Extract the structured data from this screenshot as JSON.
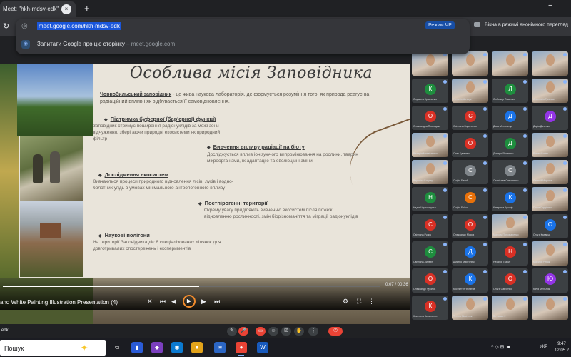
{
  "browser": {
    "tab_title": "Meet: \"hkh-mdsv-edk\"",
    "tab_close": "×",
    "new_tab": "+",
    "minimize": "−",
    "reload_icon": "↻",
    "omnibox": {
      "url": "meet.google.com/hkh-mdsv-edk",
      "suggestion_text": "Запитати Google про цю сторінку",
      "suggestion_dash": " – ",
      "suggestion_url": "meet.google.com"
    },
    "reading_mode": "Режим ЧР",
    "incognito_text": "Вікна в режимі анонімного перегляд"
  },
  "slide": {
    "title": "Особлива місія Заповідника",
    "intro_bold": "Чорнобильський заповідник",
    "intro_rest": " - це жива наукова лабораторія, де формується розуміння того, як природа реагує на радіаційний вплив і як відбувається її самовідновлення.",
    "bullets": [
      {
        "heading": "Підтримка буферної (бар'єрної) функції",
        "text": "Заповідник стримує поширення радіонуклідів за межі зони відчуження, зберігаючи природні екосистеми як природний фільтр"
      },
      {
        "heading": "Вивчення впливу радіації на біоту",
        "text": "Досліджується вплив іонізуючого випромінювання на рослини, тварин і мікроорганізми, їх адаптацію та еволюційні зміни"
      },
      {
        "heading": "Дослідження екосистем",
        "text": "Вивчаються процеси природного відновлення лісів, луків і водно-болотних угідь в умовах мінімального антропогенного впливу"
      },
      {
        "heading": "Постпірогенні території",
        "text": "Окрему увагу приділяють вивченню екосистем після пожеж: відновленню рослинності, змін біорізноманіття та міграції радіонуклідів"
      },
      {
        "heading": "Наукові полігони",
        "text": "На території Заповідника діє 8 спеціалізованих ділянок для довготривалих спостережень і експериментів"
      }
    ]
  },
  "player": {
    "title": "and White Painting Illustration Presentation (4)",
    "time": "0:07 / 00:36",
    "progress": 0.52,
    "controls": {
      "close": "✕",
      "prev": "⏮",
      "back": "◀",
      "play": "▶",
      "fwd": "▶",
      "next": "⏭",
      "settings": "⚙",
      "fullscreen": "⛶",
      "more": "⋮"
    }
  },
  "participants": [
    {
      "initial": "",
      "name": "",
      "color": "#5f6368",
      "photo": true
    },
    {
      "initial": "",
      "name": "",
      "color": "#5f6368",
      "photo": true
    },
    {
      "initial": "",
      "name": "",
      "color": "#5f6368",
      "photo": true
    },
    {
      "initial": "",
      "name": "",
      "color": "#5f6368",
      "photo": true
    },
    {
      "initial": "К",
      "name": "Людмила Кравченко",
      "color": "#1e8e3e",
      "photo": false
    },
    {
      "initial": "",
      "name": "Наталія Шевчук",
      "color": "#5f6368",
      "photo": true
    },
    {
      "initial": "Л",
      "name": "Любомир Ляшенко",
      "color": "#1e8e3e",
      "photo": false
    },
    {
      "initial": "",
      "name": "Анастасія Гринчак",
      "color": "#5f6368",
      "photo": true
    },
    {
      "initial": "О",
      "name": "Олександра Приходько",
      "color": "#d93025",
      "photo": false
    },
    {
      "initial": "С",
      "name": "Світлана Кириленко",
      "color": "#d93025",
      "photo": false
    },
    {
      "initial": "Д",
      "name": "Дана Мельничук",
      "color": "#1a73e8",
      "photo": false
    },
    {
      "initial": "Д",
      "name": "Дарія Дяченко",
      "color": "#9334e6",
      "photo": false
    },
    {
      "initial": "",
      "name": "Валерія Михайленко",
      "color": "#5f6368",
      "photo": true
    },
    {
      "initial": "О",
      "name": "Олег Гуменюк",
      "color": "#d93025",
      "photo": false
    },
    {
      "initial": "Д",
      "name": "Дмитро Яковенко",
      "color": "#1e8e3e",
      "photo": false
    },
    {
      "initial": "",
      "name": "Роман Бойко",
      "color": "#5f6368",
      "photo": true
    },
    {
      "initial": "",
      "name": "Вероніка Бондар",
      "color": "#5f6368",
      "photo": true
    },
    {
      "initial": "С",
      "name": "Софія Бакай",
      "color": "#80868b",
      "photo": false
    },
    {
      "initial": "С",
      "name": "Станіслав Симоненко",
      "color": "#80868b",
      "photo": false
    },
    {
      "initial": "",
      "name": "Євгеній Морозов",
      "color": "#5f6368",
      "photo": true
    },
    {
      "initial": "Н",
      "name": "Надія Чорноморець",
      "color": "#1e8e3e",
      "photo": false
    },
    {
      "initial": "С",
      "name": "Софія Бойко",
      "color": "#e8710a",
      "photo": false
    },
    {
      "initial": "К",
      "name": "Катерина Кушнір",
      "color": "#1a73e8",
      "photo": false
    },
    {
      "initial": "",
      "name": "Ганна Гордієнко",
      "color": "#5f6368",
      "photo": true
    },
    {
      "initial": "С",
      "name": "Світлана Рудик",
      "color": "#d93025",
      "photo": false
    },
    {
      "initial": "О",
      "name": "Олександр Мороз",
      "color": "#d93025",
      "photo": false
    },
    {
      "initial": "",
      "name": "Максим Пономаренко",
      "color": "#5f6368",
      "photo": true
    },
    {
      "initial": "О",
      "name": "Ольга Кравець",
      "color": "#1a73e8",
      "photo": false
    },
    {
      "initial": "С",
      "name": "Світлана Литвин",
      "color": "#1e8e3e",
      "photo": false
    },
    {
      "initial": "Д",
      "name": "Дмитро Мартинюк",
      "color": "#1a73e8",
      "photo": false
    },
    {
      "initial": "Н",
      "name": "Наталія Ткачук",
      "color": "#d93025",
      "photo": false
    },
    {
      "initial": "",
      "name": "Марина Рибак",
      "color": "#5f6368",
      "photo": true
    },
    {
      "initial": "О",
      "name": "Олександр Фролов",
      "color": "#d93025",
      "photo": false
    },
    {
      "initial": "К",
      "name": "Костянтин Філатов",
      "color": "#1a73e8",
      "photo": false
    },
    {
      "initial": "О",
      "name": "Ольга Савченко",
      "color": "#d93025",
      "photo": false
    },
    {
      "initial": "Ю",
      "name": "Юлія Мельник",
      "color": "#9334e6",
      "photo": false
    },
    {
      "initial": "К",
      "name": "Кристина Кириленко",
      "color": "#d93025",
      "photo": false
    },
    {
      "initial": "",
      "name": "Тетяна Пасічник",
      "color": "#5f6368",
      "photo": true
    },
    {
      "initial": "",
      "name": "Ви та ще 2",
      "color": "#5f6368",
      "photo": true
    },
    {
      "initial": "",
      "name": "",
      "color": "#5f6368",
      "photo": true
    }
  ],
  "callbar": {
    "code": "edk",
    "buttons": [
      "✎",
      "🎤",
      "▭",
      "☺",
      "⎚",
      "✋",
      "⋮",
      "✆"
    ]
  },
  "taskbar": {
    "search": "Пошук",
    "icons": [
      "⧉",
      "▮",
      "◆",
      "◉",
      "■",
      "✉",
      "●",
      "W"
    ],
    "tray": "^ ◇ ⊞ ◄",
    "lang": "УКР",
    "time": "9:47",
    "date": "12.05.2"
  }
}
